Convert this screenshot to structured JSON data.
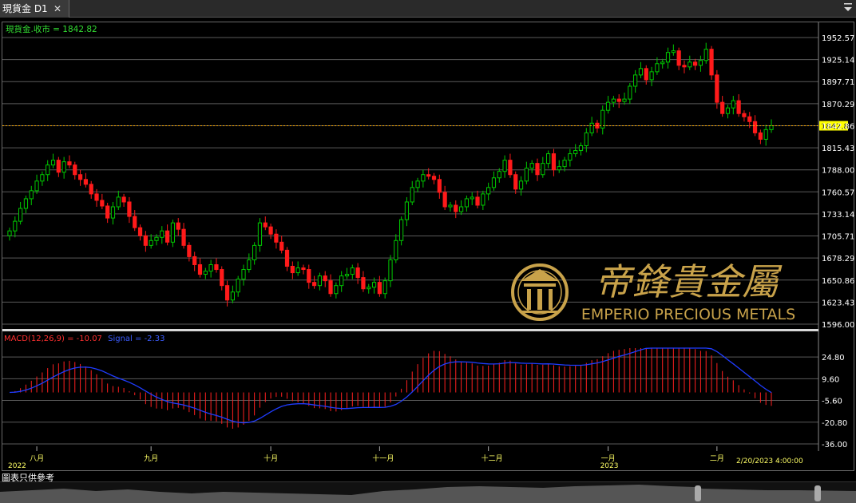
{
  "tab": {
    "title": "現貨金 D1",
    "close_glyph": "✕"
  },
  "header": {
    "legend_text": "現貨金.收市 = 1842.82",
    "macd_label": "MACD(12,26,9) = -10.07",
    "signal_label": "Signal = -2.33"
  },
  "watermark": {
    "name_zh": "帝鋒貴金屬",
    "name_en": "EMPERIO PRECIOUS METALS"
  },
  "footer": {
    "note": "圖表只供參考"
  },
  "colors": {
    "up": "#00c800",
    "down": "#ff1a1a",
    "macd_bar": "#ff2020",
    "signal": "#1f3cff",
    "grid": "#5a5a5a",
    "last_price_line": "#ffaa00",
    "last_price_tag_bg": "#ffff00",
    "gold": "#c8a24a"
  },
  "chart_data": [
    {
      "type": "candlestick",
      "title": "現貨金 D1",
      "series": [
        {
          "name": "現貨金.收市",
          "last": 1842.82
        }
      ],
      "y_ticks": [
        "1952.57",
        "1925.14",
        "1897.71",
        "1870.29",
        "1842.86",
        "1815.43",
        "1788.00",
        "1760.57",
        "1733.14",
        "1705.71",
        "1678.29",
        "1650.86",
        "1623.43",
        "1596.00"
      ],
      "ylim": [
        1596.0,
        1952.57
      ],
      "last_price": "1842.82",
      "x_labels": [
        "八月",
        "九月",
        "十月",
        "十一月",
        "十二月",
        "一月",
        "二月"
      ],
      "year_labels": [
        "2022",
        "2023"
      ],
      "last_date": "2/20/2023 4:00:00",
      "closes": [
        1712,
        1724,
        1740,
        1752,
        1762,
        1774,
        1782,
        1794,
        1800,
        1785,
        1798,
        1794,
        1782,
        1776,
        1770,
        1758,
        1750,
        1743,
        1728,
        1742,
        1754,
        1748,
        1730,
        1716,
        1706,
        1694,
        1700,
        1704,
        1712,
        1698,
        1722,
        1714,
        1694,
        1680,
        1670,
        1658,
        1662,
        1670,
        1664,
        1644,
        1626,
        1636,
        1652,
        1664,
        1676,
        1694,
        1722,
        1717,
        1708,
        1698,
        1688,
        1668,
        1660,
        1666,
        1664,
        1648,
        1644,
        1656,
        1650,
        1634,
        1644,
        1656,
        1658,
        1666,
        1654,
        1640,
        1642,
        1648,
        1634,
        1650,
        1676,
        1700,
        1726,
        1748,
        1766,
        1774,
        1782,
        1780,
        1776,
        1760,
        1742,
        1744,
        1736,
        1742,
        1752,
        1754,
        1744,
        1758,
        1766,
        1778,
        1786,
        1800,
        1782,
        1764,
        1774,
        1790,
        1796,
        1782,
        1796,
        1808,
        1788,
        1792,
        1800,
        1808,
        1812,
        1818,
        1834,
        1846,
        1840,
        1862,
        1872,
        1876,
        1873,
        1876,
        1892,
        1906,
        1914,
        1900,
        1910,
        1920,
        1922,
        1934,
        1936,
        1918,
        1916,
        1922,
        1918,
        1924,
        1938,
        1906,
        1872,
        1858,
        1865,
        1874,
        1858,
        1854,
        1848,
        1834,
        1826,
        1838,
        1842.82
      ]
    },
    {
      "type": "bar",
      "title": "MACD(12,26,9)",
      "series": [
        {
          "name": "MACD(12,26,9)",
          "last": -10.07
        },
        {
          "name": "Signal",
          "last": -2.33
        }
      ],
      "y_ticks": [
        "24.80",
        "9.60",
        "-5.60",
        "-20.80",
        "-36.00"
      ],
      "ylim": [
        -36.0,
        31.0
      ]
    }
  ]
}
